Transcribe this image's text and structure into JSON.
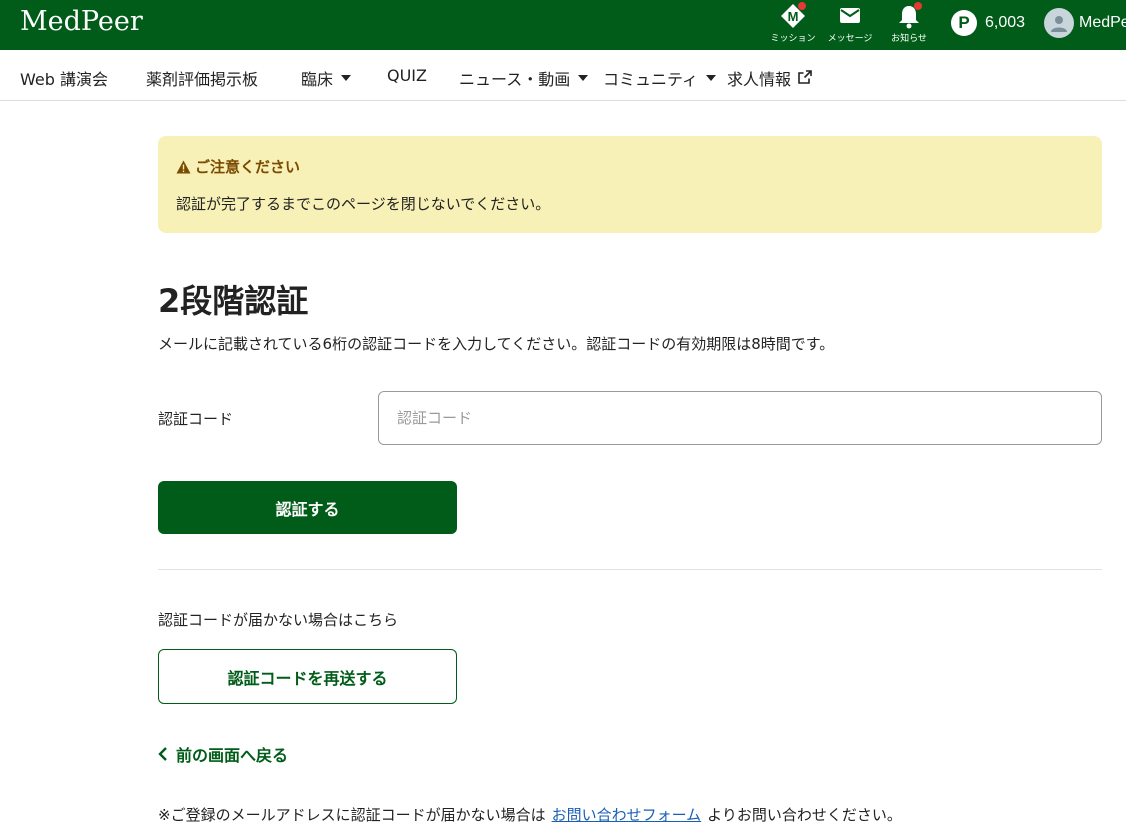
{
  "header": {
    "logo": "MedPeer",
    "mission_label": "ミッション",
    "message_label": "メッセージ",
    "notification_label": "お知らせ",
    "points": "6,003",
    "user_name": "MedPeer"
  },
  "nav": {
    "items": [
      {
        "label": "Web 講演会"
      },
      {
        "label": "薬剤評価掲示板"
      },
      {
        "label": "臨床"
      },
      {
        "label": "QUIZ"
      },
      {
        "label": "ニュース・動画"
      },
      {
        "label": "コミュニティ"
      },
      {
        "label": "求人情報"
      }
    ]
  },
  "notice": {
    "title": "ご注意ください",
    "body": "認証が完了するまでこのページを閉じないでください。"
  },
  "main": {
    "title": "2段階認証",
    "description": "メールに記載されている6桁の認証コードを入力してください。認証コードの有効期限は8時間です。",
    "code_label": "認証コード",
    "code_placeholder": "認証コード",
    "code_value": "",
    "submit_label": "認証する",
    "resend_note": "認証コードが届かない場合はこちら",
    "resend_label": "認証コードを再送する",
    "back_label": "前の画面へ戻る",
    "footer_prefix": "※ご登録のメールアドレスに認証コードが届かない場合は",
    "footer_link": "お問い合わせフォーム",
    "footer_suffix": "よりお問い合わせください。"
  },
  "colors": {
    "brand": "#005c18",
    "notice_bg": "#f7f0b7",
    "notice_title": "#7a4a00",
    "link": "#1a5fb4",
    "badge": "#e53935"
  },
  "icons": [
    "mission-icon",
    "mail-icon",
    "bell-icon",
    "points-icon",
    "avatar",
    "warning-icon",
    "external-link-icon",
    "chevron-left-icon"
  ]
}
